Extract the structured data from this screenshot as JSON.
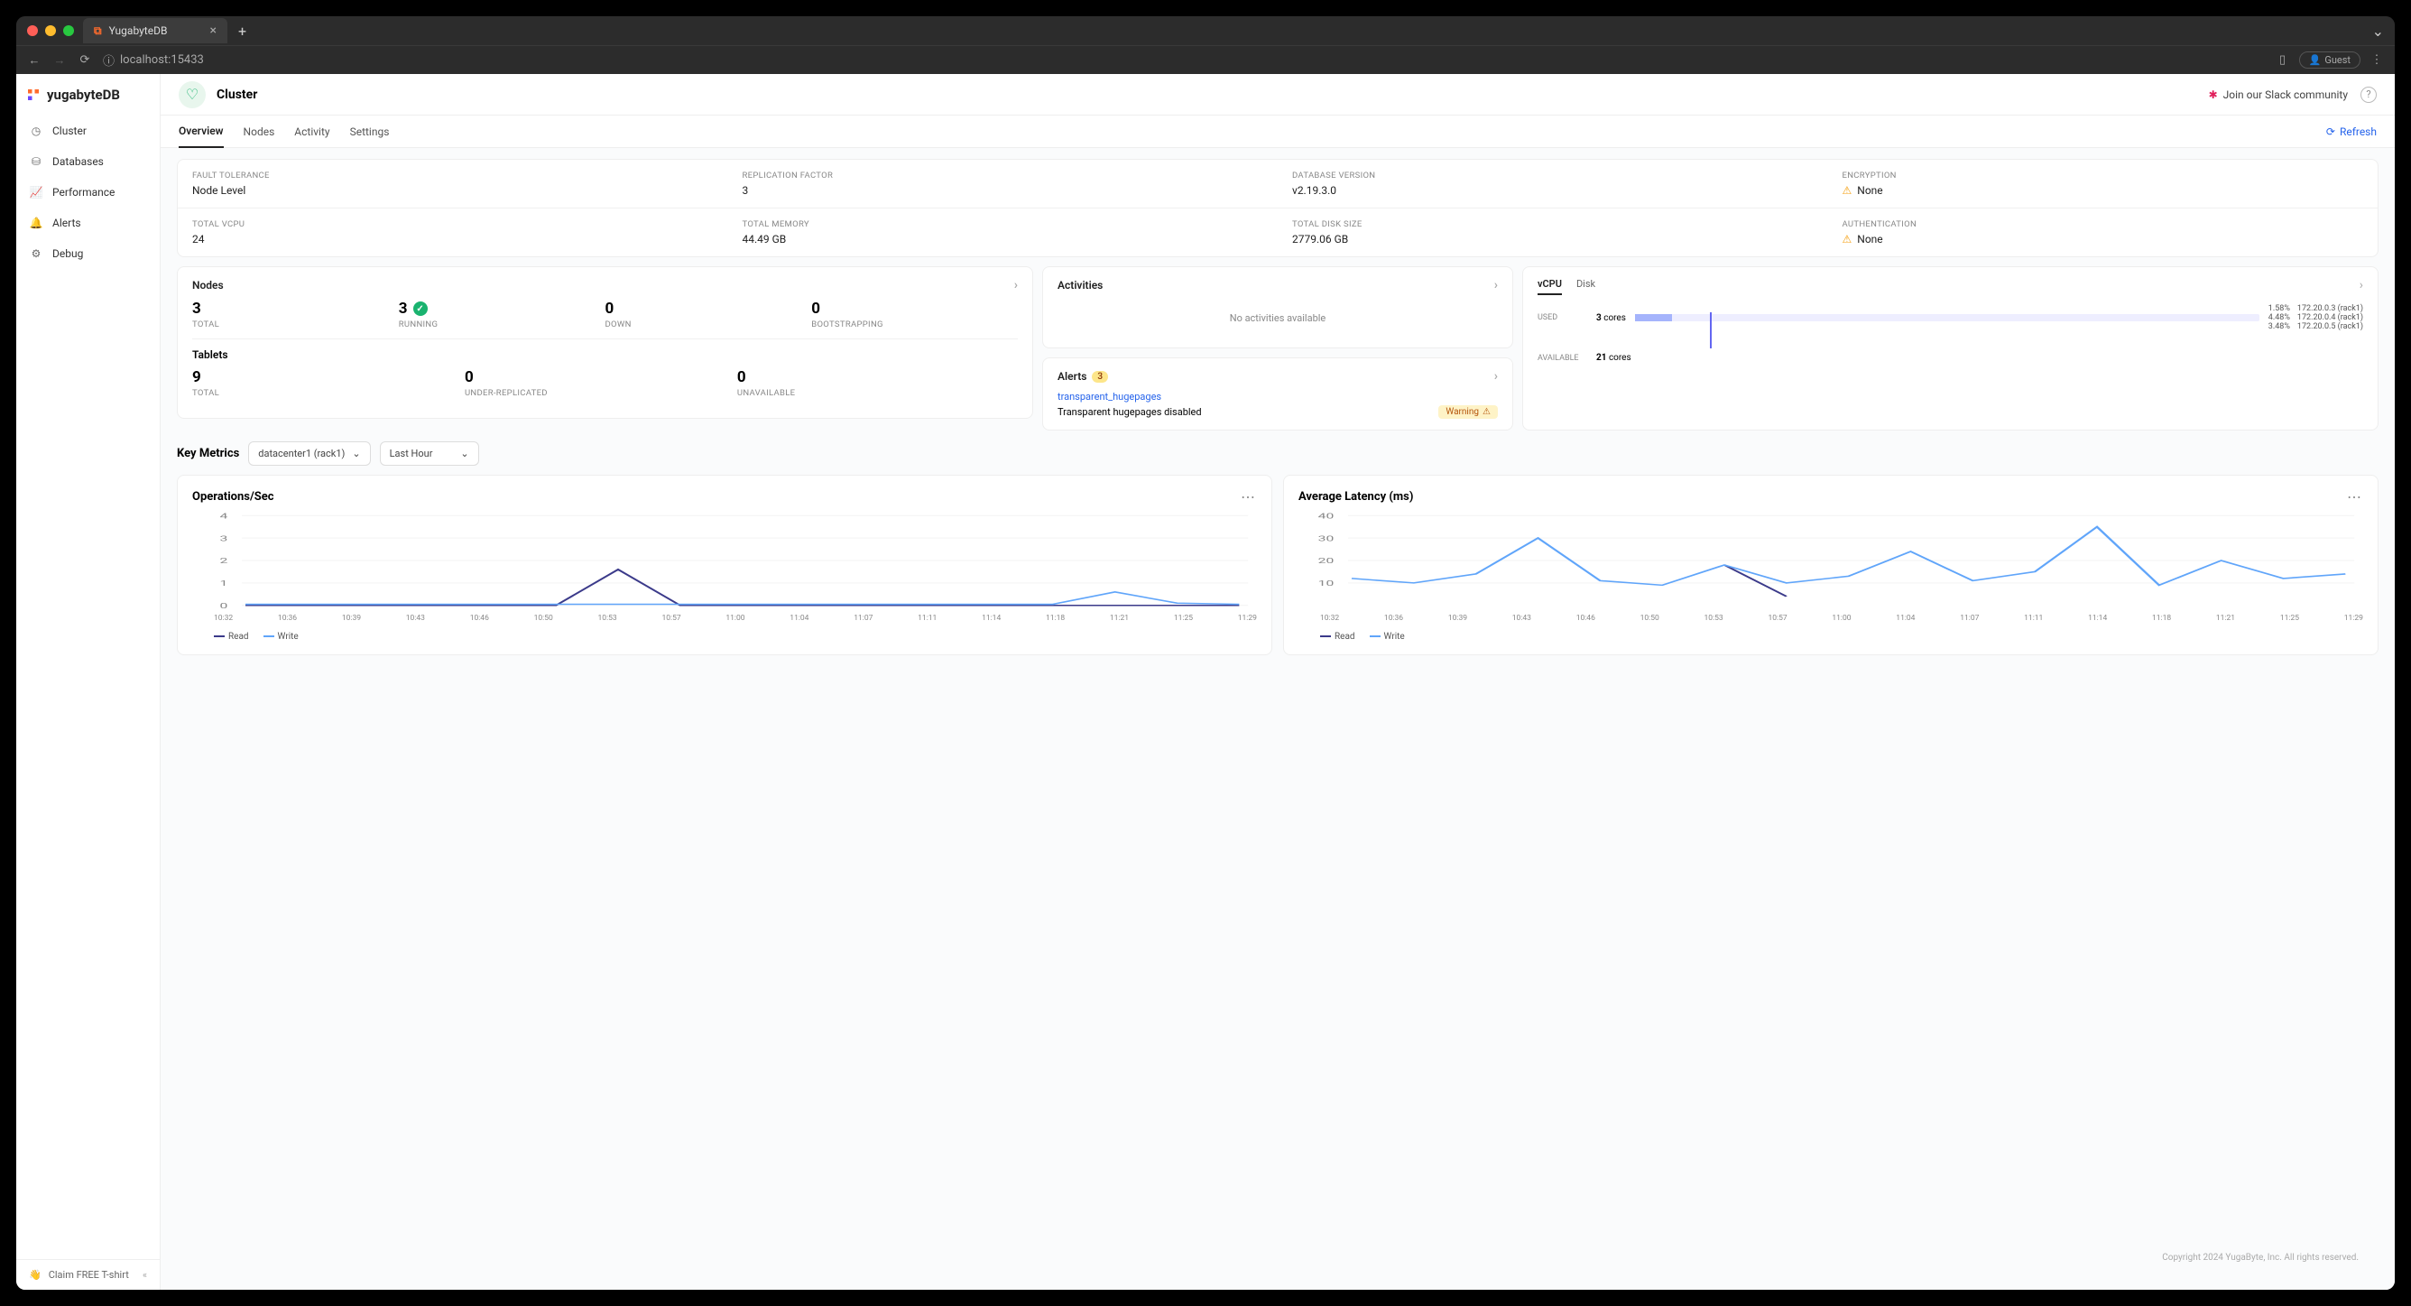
{
  "browser": {
    "tab_title": "YugabyteDB",
    "url": "localhost:15433",
    "guest": "Guest"
  },
  "logo": "yugabyteDB",
  "sidebar": {
    "items": [
      "Cluster",
      "Databases",
      "Performance",
      "Alerts",
      "Debug"
    ],
    "tshirt": "Claim FREE T-shirt"
  },
  "header": {
    "title": "Cluster",
    "slack": "Join our Slack community",
    "help": "?"
  },
  "tabs": {
    "items": [
      "Overview",
      "Nodes",
      "Activity",
      "Settings"
    ],
    "refresh": "Refresh"
  },
  "info": {
    "fault_tolerance": {
      "label": "FAULT TOLERANCE",
      "value": "Node Level"
    },
    "replication_factor": {
      "label": "REPLICATION FACTOR",
      "value": "3"
    },
    "database_version": {
      "label": "DATABASE VERSION",
      "value": "v2.19.3.0"
    },
    "encryption": {
      "label": "ENCRYPTION",
      "value": "None"
    },
    "total_vcpu": {
      "label": "TOTAL VCPU",
      "value": "24"
    },
    "total_memory": {
      "label": "TOTAL MEMORY",
      "value": "44.49 GB"
    },
    "total_disk": {
      "label": "TOTAL DISK SIZE",
      "value": "2779.06 GB"
    },
    "authentication": {
      "label": "AUTHENTICATION",
      "value": "None"
    }
  },
  "nodes": {
    "title": "Nodes",
    "stats": [
      {
        "num": "3",
        "label": "TOTAL"
      },
      {
        "num": "3",
        "label": "RUNNING",
        "check": true
      },
      {
        "num": "0",
        "label": "DOWN"
      },
      {
        "num": "0",
        "label": "BOOTSTRAPPING"
      }
    ]
  },
  "tablets": {
    "title": "Tablets",
    "stats": [
      {
        "num": "9",
        "label": "TOTAL"
      },
      {
        "num": "0",
        "label": "UNDER-REPLICATED"
      },
      {
        "num": "0",
        "label": "UNAVAILABLE"
      }
    ]
  },
  "activities": {
    "title": "Activities",
    "empty": "No activities available"
  },
  "alerts": {
    "title": "Alerts",
    "count": "3",
    "item_link": "transparent_hugepages",
    "item_text": "Transparent hugepages disabled",
    "pill": "Warning"
  },
  "vcpu_panel": {
    "tabs": [
      "vCPU",
      "Disk"
    ],
    "used_label": "USED",
    "used_val": "3",
    "used_unit": "cores",
    "avail_label": "AVAILABLE",
    "avail_val": "21",
    "avail_unit": "cores",
    "legend": [
      {
        "pct": "1.58%",
        "host": "172.20.0.3 (rack1)"
      },
      {
        "pct": "4.48%",
        "host": "172.20.0.4 (rack1)"
      },
      {
        "pct": "3.48%",
        "host": "172.20.0.5 (rack1)"
      }
    ]
  },
  "key_metrics": {
    "title": "Key Metrics",
    "region": "datacenter1 (rack1)",
    "range": "Last Hour"
  },
  "chart_data": [
    {
      "type": "line",
      "title": "Operations/Sec",
      "xlabel": "",
      "ylabel": "",
      "ylim": [
        0,
        4
      ],
      "yticks": [
        0,
        1,
        2,
        3,
        4
      ],
      "categories": [
        "10:32",
        "10:36",
        "10:39",
        "10:43",
        "10:46",
        "10:50",
        "10:53",
        "10:57",
        "11:00",
        "11:04",
        "11:07",
        "11:11",
        "11:14",
        "11:18",
        "11:21",
        "11:25",
        "11:29"
      ],
      "series": [
        {
          "name": "Read",
          "color": "#3b3a8a",
          "values": [
            0,
            0,
            0,
            0,
            0,
            0,
            1.6,
            0,
            0,
            0,
            0,
            0,
            0,
            0,
            0,
            0,
            0
          ]
        },
        {
          "name": "Write",
          "color": "#60a5fa",
          "values": [
            0.05,
            0.05,
            0.05,
            0.05,
            0.05,
            0.05,
            0.05,
            0.05,
            0.05,
            0.05,
            0.05,
            0.05,
            0.05,
            0.05,
            0.6,
            0.1,
            0.05
          ]
        }
      ]
    },
    {
      "type": "line",
      "title": "Average Latency (ms)",
      "xlabel": "",
      "ylabel": "",
      "ylim": [
        0,
        40
      ],
      "yticks": [
        10,
        20,
        30,
        40
      ],
      "categories": [
        "10:32",
        "10:36",
        "10:39",
        "10:43",
        "10:46",
        "10:50",
        "10:53",
        "10:57",
        "11:00",
        "11:04",
        "11:07",
        "11:11",
        "11:14",
        "11:18",
        "11:21",
        "11:25",
        "11:29"
      ],
      "series": [
        {
          "name": "Read",
          "color": "#3b3a8a",
          "values": [
            null,
            null,
            null,
            null,
            null,
            null,
            18,
            4,
            null,
            null,
            null,
            null,
            null,
            null,
            null,
            null,
            null
          ]
        },
        {
          "name": "Write",
          "color": "#60a5fa",
          "values": [
            12,
            10,
            14,
            30,
            11,
            9,
            18,
            10,
            13,
            24,
            11,
            15,
            35,
            9,
            20,
            12,
            14
          ]
        }
      ]
    }
  ],
  "footer": "Copyright 2024 YugaByte, Inc. All rights reserved."
}
